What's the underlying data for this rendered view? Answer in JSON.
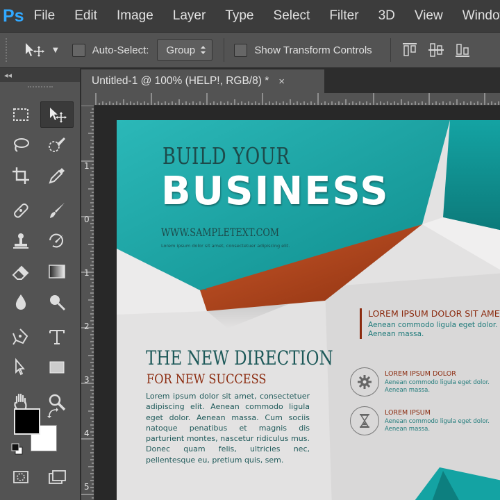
{
  "app": {
    "logo": "Ps",
    "menu": [
      "File",
      "Edit",
      "Image",
      "Layer",
      "Type",
      "Select",
      "Filter",
      "3D",
      "View",
      "Window"
    ]
  },
  "options": {
    "auto_select_label": "Auto-Select:",
    "auto_select_checked": false,
    "auto_select_target": "Group",
    "show_transform_label": "Show Transform Controls",
    "show_transform_checked": false
  },
  "tools_panel": {
    "collapse_glyph": "◂◂"
  },
  "document": {
    "tab_title": "Untitled-1 @ 100% (HELP!, RGB/8) *",
    "close_glyph": "×"
  },
  "rulers": {
    "vertical_labels": [
      "1",
      "0",
      "1",
      "2",
      "3",
      "4",
      "5"
    ]
  },
  "colors": {
    "foreground": "#000000",
    "background": "#ffffff",
    "teal": "#14a3a3",
    "rust": "#b54820",
    "ps_blue": "#31a8ff"
  },
  "flyer": {
    "title_line1": "BUILD YOUR",
    "title_line2": "BUSINESS",
    "url": "WWW.SAMPLETEXT.COM",
    "tagline": "Lorem ipsum dolor sit amet,  consectetuer adipiscing elit.",
    "section_title": "THE NEW DIRECTION",
    "section_subtitle": "FOR NEW SUCCESS",
    "body": "Lorem ipsum dolor sit amet, consectetuer adipiscing elit. Aenean commodo ligula eget dolor. Aenean massa. Cum sociis natoque penatibus et magnis dis parturient montes, nascetur ridiculus mus. Donec quam felis, ultricies nec, pellentesque eu, pretium quis, sem.",
    "right_heading": "LOREM IPSUM DOLOR SIT AMET",
    "right_text": "Aenean commodo ligula eget dolor. Aenean massa.",
    "features": [
      {
        "icon": "gear-icon",
        "title": "LOREM IPSUM DOLOR",
        "text": "Aenean commodo ligula eget dolor. Aenean massa."
      },
      {
        "icon": "hourglass-icon",
        "title": "LOREM IPSUM",
        "text": "Aenean commodo ligula eget dolor. Aenean massa."
      }
    ]
  }
}
